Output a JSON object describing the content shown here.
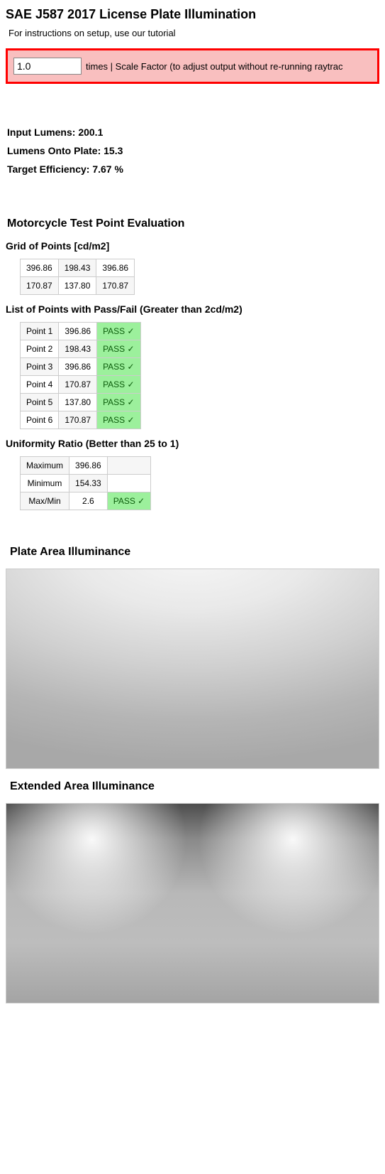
{
  "title": "SAE J587 2017 License Plate Illumination",
  "instructions": "For instructions on setup, use our tutorial",
  "scale": {
    "value": "1.0",
    "label": "times | Scale Factor (to adjust output without re-running raytrac"
  },
  "stats": {
    "input_lumens_label": "Input Lumens:",
    "input_lumens_value": "200.1",
    "onto_plate_label": "Lumens Onto Plate:",
    "onto_plate_value": "15.3",
    "efficiency_label": "Target Efficiency:",
    "efficiency_value": "7.67 %"
  },
  "eval_title": "Motorcycle Test Point Evaluation",
  "grid_title": "Grid of Points [cd/m2]",
  "grid": {
    "r0": {
      "c0": "396.86",
      "c1": "198.43",
      "c2": "396.86"
    },
    "r1": {
      "c0": "170.87",
      "c1": "137.80",
      "c2": "170.87"
    }
  },
  "points_title": "List of Points with Pass/Fail (Greater than 2cd/m2)",
  "pass_text": "PASS ✓",
  "points": {
    "p0": {
      "name": "Point 1",
      "val": "396.86"
    },
    "p1": {
      "name": "Point 2",
      "val": "198.43"
    },
    "p2": {
      "name": "Point 3",
      "val": "396.86"
    },
    "p3": {
      "name": "Point 4",
      "val": "170.87"
    },
    "p4": {
      "name": "Point 5",
      "val": "137.80"
    },
    "p5": {
      "name": "Point 6",
      "val": "170.87"
    }
  },
  "uniformity_title": "Uniformity Ratio (Better than 25 to 1)",
  "uniformity": {
    "max_label": "Maximum",
    "max_val": "396.86",
    "min_label": "Minimum",
    "min_val": "154.33",
    "ratio_label": "Max/Min",
    "ratio_val": "2.6"
  },
  "plate_title": "Plate Area Illuminance",
  "extended_title": "Extended Area Illuminance"
}
